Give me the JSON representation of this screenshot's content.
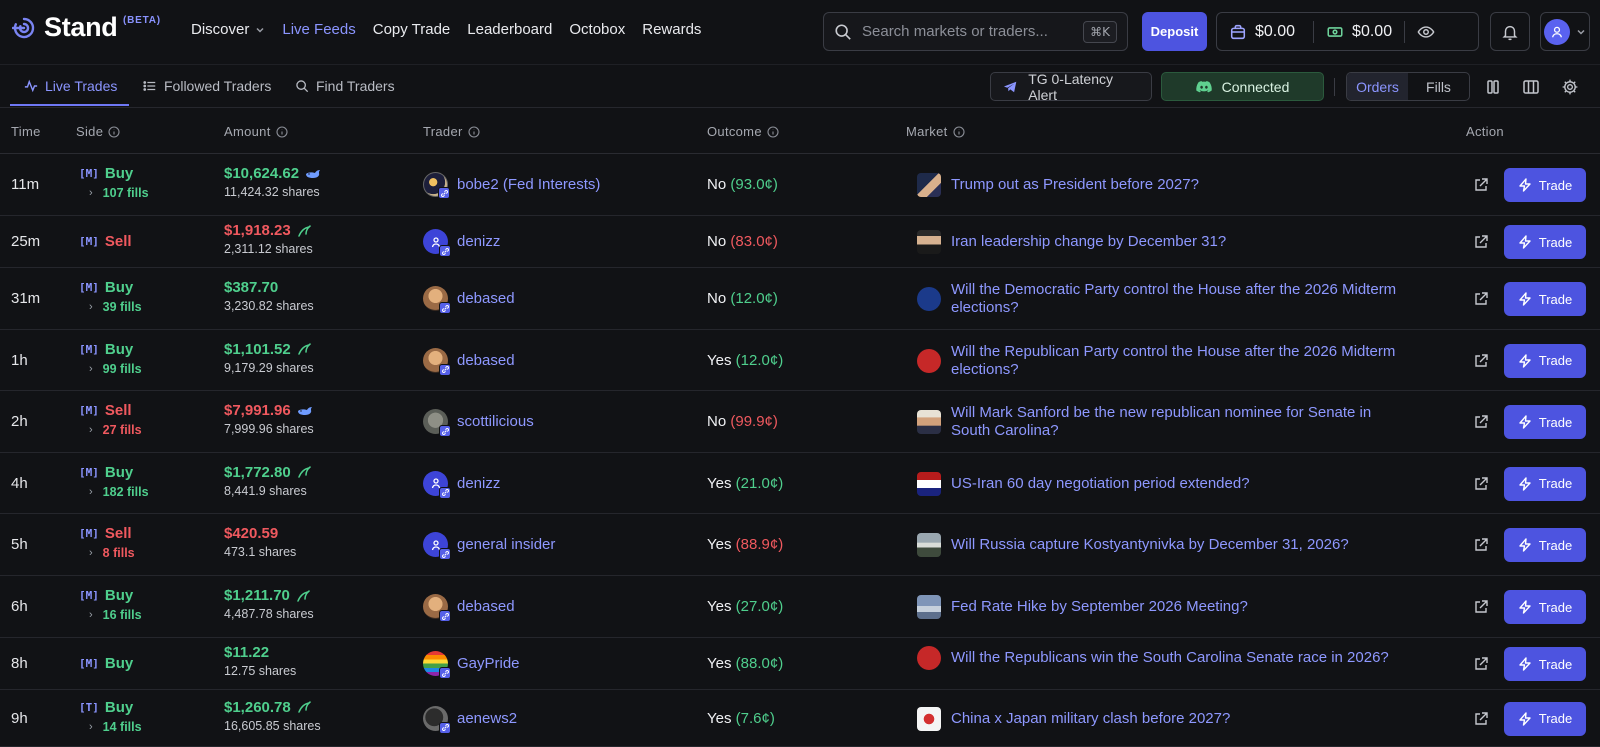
{
  "app": {
    "brand": "Stand",
    "beta": "(BETA)",
    "accent": "#4d54e0"
  },
  "nav": [
    {
      "label": "Discover",
      "dropdown": true
    },
    {
      "label": "Live Feeds",
      "active": true
    },
    {
      "label": "Copy Trade"
    },
    {
      "label": "Leaderboard"
    },
    {
      "label": "Octobox"
    },
    {
      "label": "Rewards"
    }
  ],
  "search": {
    "placeholder": "Search markets or traders...",
    "shortcut": "⌘K"
  },
  "header": {
    "deposit_label": "Deposit",
    "balance_1": "$0.00",
    "balance_2": "$0.00"
  },
  "subtabs": [
    {
      "label": "Live Trades",
      "active": true
    },
    {
      "label": "Followed Traders"
    },
    {
      "label": "Find Traders"
    }
  ],
  "toolbar": {
    "tg_label": "TG 0-Latency Alert",
    "connected_label": "Connected",
    "orders_label": "Orders",
    "fills_label": "Fills"
  },
  "columns": {
    "time": "Time",
    "side": "Side",
    "amount": "Amount",
    "trader": "Trader",
    "outcome": "Outcome",
    "market": "Market",
    "action": "Action"
  },
  "trade_label": "Trade",
  "rows": [
    {
      "time": "11m",
      "tag": "[M]",
      "side": "Buy",
      "fills": "107 fills",
      "amount": "$10,624.62",
      "shares": "11,424.32 shares",
      "size_icon": "whale-icon",
      "trader": "bobe2 (Fed Interests)",
      "outcome": "No",
      "price": "(93.0¢)",
      "market": "Trump out as President before 2027?"
    },
    {
      "time": "25m",
      "tag": "[M]",
      "side": "Sell",
      "fills": "",
      "amount": "$1,918.23",
      "shares": "2,311.12 shares",
      "size_icon": "dolphin-icon",
      "trader": "denizz",
      "outcome": "No",
      "price": "(83.0¢)",
      "market": "Iran leadership change by December 31?"
    },
    {
      "time": "31m",
      "tag": "[M]",
      "side": "Buy",
      "fills": "39 fills",
      "amount": "$387.70",
      "shares": "3,230.82 shares",
      "size_icon": "",
      "trader": "debased",
      "outcome": "No",
      "price": "(12.0¢)",
      "market": "Will the Democratic Party control the House after the 2026 Midterm elections?"
    },
    {
      "time": "1h",
      "tag": "[M]",
      "side": "Buy",
      "fills": "99 fills",
      "amount": "$1,101.52",
      "shares": "9,179.29 shares",
      "size_icon": "dolphin-icon",
      "trader": "debased",
      "outcome": "Yes",
      "price": "(12.0¢)",
      "market": "Will the Republican Party control the House after the 2026 Midterm elections?"
    },
    {
      "time": "2h",
      "tag": "[M]",
      "side": "Sell",
      "fills": "27 fills",
      "amount": "$7,991.96",
      "shares": "7,999.96 shares",
      "size_icon": "whale-icon",
      "trader": "scottilicious",
      "outcome": "No",
      "price": "(99.9¢)",
      "market": "Will Mark Sanford be the new republican nominee for Senate in South Carolina?"
    },
    {
      "time": "4h",
      "tag": "[M]",
      "side": "Buy",
      "fills": "182 fills",
      "amount": "$1,772.80",
      "shares": "8,441.9 shares",
      "size_icon": "dolphin-icon",
      "trader": "denizz",
      "outcome": "Yes",
      "price": "(21.0¢)",
      "market": "US-Iran 60 day negotiation period extended?"
    },
    {
      "time": "5h",
      "tag": "[M]",
      "side": "Sell",
      "fills": "8 fills",
      "amount": "$420.59",
      "shares": "473.1 shares",
      "size_icon": "",
      "trader": "general insider",
      "outcome": "Yes",
      "price": "(88.9¢)",
      "market": "Will Russia capture Kostyantynivka by December 31, 2026?"
    },
    {
      "time": "6h",
      "tag": "[M]",
      "side": "Buy",
      "fills": "16 fills",
      "amount": "$1,211.70",
      "shares": "4,487.78 shares",
      "size_icon": "dolphin-icon",
      "trader": "debased",
      "outcome": "Yes",
      "price": "(27.0¢)",
      "market": "Fed Rate Hike by September 2026 Meeting?"
    },
    {
      "time": "8h",
      "tag": "[M]",
      "side": "Buy",
      "fills": "",
      "amount": "$11.22",
      "shares": "12.75 shares",
      "size_icon": "",
      "trader": "GayPride",
      "outcome": "Yes",
      "price": "(88.0¢)",
      "market": "Will the Republicans win the South Carolina Senate race in 2026?"
    },
    {
      "time": "9h",
      "tag": "[T]",
      "side": "Buy",
      "fills": "14 fills",
      "amount": "$1,260.78",
      "shares": "16,605.85 shares",
      "size_icon": "dolphin-icon",
      "trader": "aenews2",
      "outcome": "Yes",
      "price": "(7.6¢)",
      "market": "China x Japan military clash before 2027?"
    }
  ]
}
